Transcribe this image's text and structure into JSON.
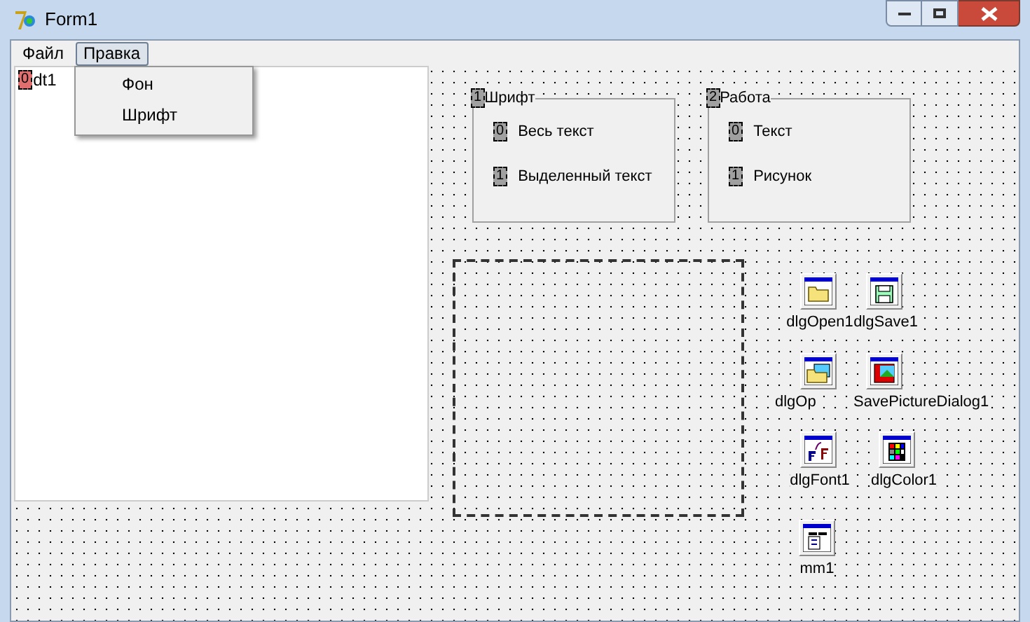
{
  "window": {
    "title": "Form1"
  },
  "menu": [
    {
      "label": "Файл",
      "selected": false
    },
    {
      "label": "Правка",
      "selected": true
    }
  ],
  "dropdown": [
    "Фон",
    "Шрифт"
  ],
  "memo": {
    "tab_order": "0",
    "text": "dt1"
  },
  "groups": [
    {
      "tab_order": "1",
      "title": "Шрифт",
      "options": [
        {
          "tab_order": "0",
          "label": "Весь текст"
        },
        {
          "tab_order": "1",
          "label": "Выделенный текст"
        }
      ]
    },
    {
      "tab_order": "2",
      "title": "Работа",
      "options": [
        {
          "tab_order": "0",
          "label": "Текст"
        },
        {
          "tab_order": "1",
          "label": "Рисунок"
        }
      ]
    }
  ],
  "components": [
    {
      "kind": "open",
      "label": "dlgOpen1"
    },
    {
      "kind": "save",
      "label": "dlgSave1"
    },
    {
      "kind": "open_picture",
      "label": "dlgOp"
    },
    {
      "kind": "save_picture",
      "label": "SavePictureDialog1"
    },
    {
      "kind": "font",
      "label": "dlgFont1"
    },
    {
      "kind": "color",
      "label": "dlgColor1"
    },
    {
      "kind": "menu",
      "label": "mm1"
    }
  ]
}
